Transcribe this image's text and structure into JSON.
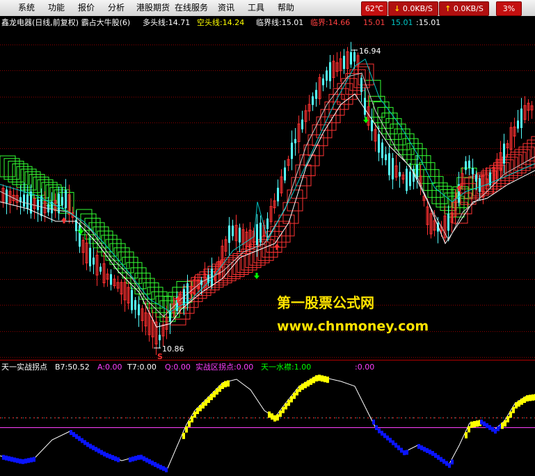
{
  "menu": [
    {
      "label": "系统"
    },
    {
      "label": "功能"
    },
    {
      "label": "报价"
    },
    {
      "label": "分析"
    },
    {
      "label": "港股期货"
    },
    {
      "label": "在线服务"
    },
    {
      "label": "资讯"
    },
    {
      "label": "工具"
    },
    {
      "label": "帮助"
    }
  ],
  "status": {
    "temperature": "62℃",
    "download": "0.0KB/S",
    "upload": "0.0KB/S",
    "percent": "3%"
  },
  "main_panel": {
    "title": "鑫龙电器(日线,前复权) 霸占大牛股(6)",
    "items": [
      {
        "label": "多头线:",
        "value": "14.71",
        "color": "#ffffff"
      },
      {
        "label": "空头线:",
        "value": "14.24",
        "color": "#ffff00"
      },
      {
        "label": "临界线:",
        "value": "15.01",
        "color": "#ffffff"
      },
      {
        "label": "临界:",
        "value": "14.66",
        "color": "#ff4040"
      },
      {
        "label": "",
        "value": "15.01",
        "color": "#ff4040"
      },
      {
        "label": "",
        "value": "15.01",
        "color": "#00c8c8"
      },
      {
        "label": ":",
        "value": "15.01",
        "color": "#ffffff"
      }
    ],
    "high_label": "16.94",
    "low_label": "10.86",
    "signal_label": "S"
  },
  "watermark": {
    "line1": "第一股票公式网",
    "line2": "www.chnmoney.com"
  },
  "sub_panel": {
    "title": "天一实战拐点",
    "items": [
      {
        "label": "B7:",
        "value": "50.52",
        "color": "#ffffff"
      },
      {
        "label": "A:",
        "value": "0.00",
        "color": "#ff40ff"
      },
      {
        "label": "T7:",
        "value": "0.00",
        "color": "#ffffff"
      },
      {
        "label": "Q:",
        "value": "0.00",
        "color": "#ff40ff"
      },
      {
        "label": "实战区拐点:",
        "value": "0.00",
        "color": "#ff40ff"
      },
      {
        "label": "天一水襟:",
        "value": "1.00",
        "color": "#00ff00"
      },
      {
        "label": ":",
        "value": "0.00",
        "color": "#ff40ff"
      }
    ]
  },
  "colors": {
    "up": "#ff3030",
    "down": "#54ffff",
    "ribbon_green": "#33ff33",
    "ribbon_red": "#ff3333",
    "grid": "#8b0000",
    "yellow_bar": "#ffff00",
    "blue_bar": "#0a14ff"
  }
}
